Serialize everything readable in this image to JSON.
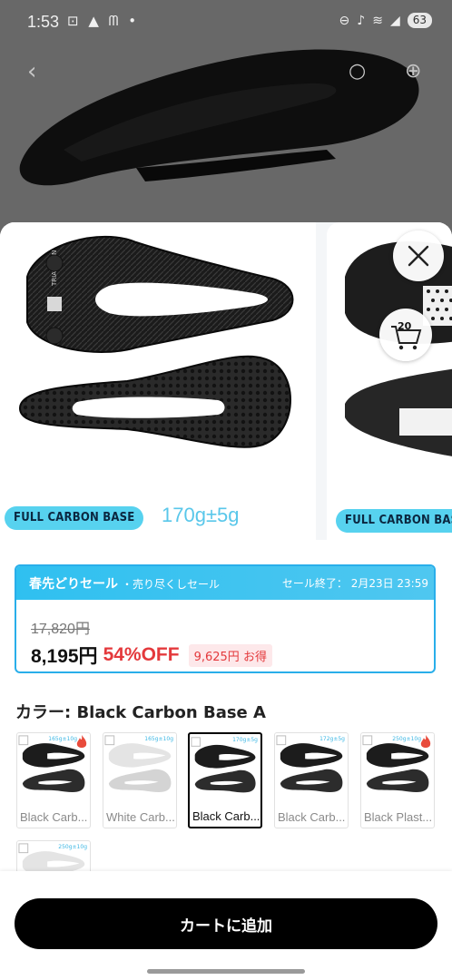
{
  "status_bar": {
    "time": "1:53",
    "left_icons": [
      "screenshot-icon",
      "warning-icon",
      "mcdonalds-icon",
      "dot-icon"
    ],
    "battery": "63"
  },
  "gallery": {
    "slide1": {
      "badge": "FULL CARBON BASE",
      "weight": "170g±5g"
    },
    "slide2": {
      "badge": "FULL CARBON BASE"
    },
    "cart_count": "20"
  },
  "sale": {
    "title": "春先どりセール",
    "subtitle": "・売り尽くしセール",
    "end": "セール終了：  2月23日 23:59",
    "old_price": "17,820円",
    "price": "8,195円",
    "discount": "54%OFF",
    "saving": "9,625円 お得"
  },
  "color": {
    "label": "カラー: Black Carbon Base A",
    "swatches": [
      {
        "label": "Black Carb...",
        "tag": "165g±10g",
        "selected": false,
        "hot": true,
        "light": false
      },
      {
        "label": "White Carb...",
        "tag": "165g±10g",
        "selected": false,
        "hot": false,
        "light": true
      },
      {
        "label": "Black Carb...",
        "tag": "170g±5g",
        "selected": true,
        "hot": false,
        "light": false
      },
      {
        "label": "Black Carb...",
        "tag": "172g±5g",
        "selected": false,
        "hot": false,
        "light": false
      },
      {
        "label": "Black Plast...",
        "tag": "250g±10g",
        "selected": false,
        "hot": true,
        "light": false
      },
      {
        "label": "",
        "tag": "250g±10g",
        "selected": false,
        "hot": false,
        "light": true
      }
    ]
  },
  "actions": {
    "add_to_cart": "カートに追加"
  },
  "colors": {
    "accent_blue": "#2fc0f0",
    "sale_red": "#e4393c",
    "badge_cyan": "#57d2ef"
  }
}
